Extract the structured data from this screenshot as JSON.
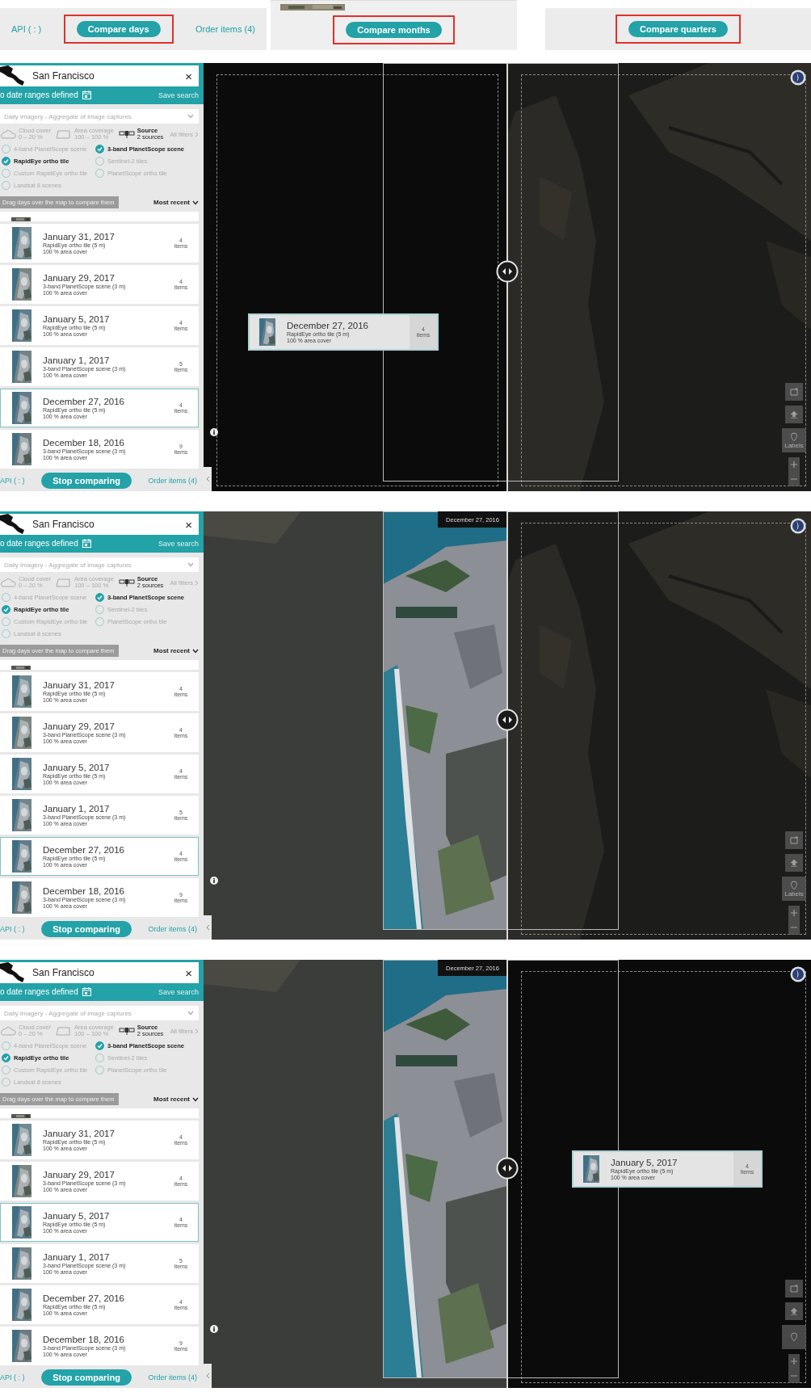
{
  "top_strip": [
    {
      "kind": "footer",
      "left_link": "API ( : )",
      "button": {
        "label": "Compare days",
        "highlighted": true
      },
      "right_link": "Order items (4)"
    },
    {
      "kind": "image_top",
      "button": {
        "label": "Compare months",
        "highlighted": true
      }
    },
    {
      "kind": "plain",
      "button": {
        "label": "Compare quarters",
        "highlighted": true
      }
    }
  ],
  "screens": [
    {
      "sidebar": {
        "search": {
          "value": "San Francisco",
          "close": "×"
        },
        "date_range": "o date ranges defined",
        "save_search": "Save search",
        "imagery_type": "Daily imagery - Aggregate of image captures",
        "filters": [
          {
            "kind": "cloud",
            "label": "Cloud cover",
            "value": "0 – 20 %",
            "active": false
          },
          {
            "kind": "area",
            "label": "Area coverage",
            "value": "100 – 100 %",
            "active": false
          },
          {
            "kind": "source",
            "label": "Source",
            "value": "2 sources",
            "active": true
          }
        ],
        "all_filters": "All filters",
        "sources": [
          {
            "label": "4-band PlanetScope scene",
            "checked": false
          },
          {
            "label": "3-band PlanetScope scene",
            "checked": true
          },
          {
            "label": "RapidEye ortho tile",
            "checked": true
          },
          {
            "label": "Sentinel-2 tiles",
            "checked": false
          },
          {
            "label": "Custom RapidEye ortho tile",
            "checked": false
          },
          {
            "label": "PlanetScope ortho tile",
            "checked": false
          },
          {
            "label": "Landsat 8 scenes",
            "checked": false
          }
        ],
        "hint": "Drag days over the map to compare them",
        "sort": "Most recent",
        "days": [
          {
            "date": "January 31, 2017",
            "source": "RapidEye ortho tile (5 m)",
            "cover": "100 % area cover",
            "count": "4",
            "unit": "items",
            "selected": false
          },
          {
            "date": "January 29, 2017",
            "source": "3-band PlanetScope scene (3 m)",
            "cover": "100 % area cover",
            "count": "4",
            "unit": "items",
            "selected": false
          },
          {
            "date": "January 5, 2017",
            "source": "RapidEye ortho tile (5 m)",
            "cover": "100 % area cover",
            "count": "4",
            "unit": "items",
            "selected": false
          },
          {
            "date": "January 1, 2017",
            "source": "3-band PlanetScope scene (3 m)",
            "cover": "100 % area cover",
            "count": "5",
            "unit": "items",
            "selected": false
          },
          {
            "date": "December 27, 2016",
            "source": "RapidEye ortho tile (5 m)",
            "cover": "100 % area cover",
            "count": "4",
            "unit": "items",
            "selected": true
          },
          {
            "date": "December 18, 2016",
            "source": "3-band PlanetScope scene (3 m)",
            "cover": "100 % area cover",
            "count": "9",
            "unit": "items",
            "selected": false
          }
        ],
        "footer": {
          "api": "API ( : )",
          "button": "Stop comparing",
          "order": "Order items (4)"
        }
      },
      "map": {
        "left_layer": {
          "kind": "black"
        },
        "right_layer": {
          "kind": "satellite"
        },
        "drag_card": {
          "kind": "left",
          "date": "December 27, 2016",
          "source": "RapidEye ortho tile (5 m)",
          "cover": "100 % area cover",
          "count": "4",
          "unit": "items"
        },
        "labels_control": "Labels"
      }
    },
    {
      "sidebar": {
        "search": {
          "value": "San Francisco",
          "close": "×"
        },
        "date_range": "o date ranges defined",
        "save_search": "Save search",
        "imagery_type": "Daily imagery - Aggregate of image captures",
        "filters": [
          {
            "kind": "cloud",
            "label": "Cloud cover",
            "value": "0 – 20 %",
            "active": false
          },
          {
            "kind": "area",
            "label": "Area coverage",
            "value": "100 – 100 %",
            "active": false
          },
          {
            "kind": "source",
            "label": "Source",
            "value": "2 sources",
            "active": true
          }
        ],
        "all_filters": "All filters",
        "sources": [
          {
            "label": "4-band PlanetScope scene",
            "checked": false
          },
          {
            "label": "3-band PlanetScope scene",
            "checked": true
          },
          {
            "label": "RapidEye ortho tile",
            "checked": true
          },
          {
            "label": "Sentinel-2 tiles",
            "checked": false
          },
          {
            "label": "Custom RapidEye ortho tile",
            "checked": false
          },
          {
            "label": "PlanetScope ortho tile",
            "checked": false
          },
          {
            "label": "Landsat 8 scenes",
            "checked": false
          }
        ],
        "hint": "Drag days over the map to compare them",
        "sort": "Most recent",
        "days": [
          {
            "date": "January 31, 2017",
            "source": "RapidEye ortho tile (5 m)",
            "cover": "100 % area cover",
            "count": "4",
            "unit": "items",
            "selected": false
          },
          {
            "date": "January 29, 2017",
            "source": "3-band PlanetScope scene (3 m)",
            "cover": "100 % area cover",
            "count": "4",
            "unit": "items",
            "selected": false
          },
          {
            "date": "January 5, 2017",
            "source": "RapidEye ortho tile (5 m)",
            "cover": "100 % area cover",
            "count": "4",
            "unit": "items",
            "selected": false
          },
          {
            "date": "January 1, 2017",
            "source": "3-band PlanetScope scene (3 m)",
            "cover": "100 % area cover",
            "count": "5",
            "unit": "items",
            "selected": false
          },
          {
            "date": "December 27, 2016",
            "source": "RapidEye ortho tile (5 m)",
            "cover": "100 % area cover",
            "count": "4",
            "unit": "items",
            "selected": true
          },
          {
            "date": "December 18, 2016",
            "source": "3-band PlanetScope scene (3 m)",
            "cover": "100 % area cover",
            "count": "9",
            "unit": "items",
            "selected": false
          }
        ],
        "footer": {
          "api": "API ( : )",
          "button": "Stop comparing",
          "order": "Order items (4)"
        }
      },
      "map": {
        "left_layer": {
          "kind": "satellite"
        },
        "right_layer": {
          "kind": "satellite"
        },
        "frame_label": "December 27, 2016",
        "labels_control": "Labels"
      }
    },
    {
      "sidebar": {
        "search": {
          "value": "San Francisco",
          "close": "×"
        },
        "date_range": "o date ranges defined",
        "save_search": "Save search",
        "imagery_type": "Daily imagery - Aggregate of image captures",
        "filters": [
          {
            "kind": "cloud",
            "label": "Cloud cover",
            "value": "0 – 20 %",
            "active": false
          },
          {
            "kind": "area",
            "label": "Area coverage",
            "value": "100 – 100 %",
            "active": false
          },
          {
            "kind": "source",
            "label": "Source",
            "value": "2 sources",
            "active": true
          }
        ],
        "all_filters": "All filters",
        "sources": [
          {
            "label": "4-band PlanetScope scene",
            "checked": false
          },
          {
            "label": "3-band PlanetScope scene",
            "checked": true
          },
          {
            "label": "RapidEye ortho tile",
            "checked": true
          },
          {
            "label": "Sentinel-2 tiles",
            "checked": false
          },
          {
            "label": "Custom RapidEye ortho tile",
            "checked": false
          },
          {
            "label": "PlanetScope ortho tile",
            "checked": false
          },
          {
            "label": "Landsat 8 scenes",
            "checked": false
          }
        ],
        "hint": "Drag days over the map to compare them",
        "sort": "Most recent",
        "days": [
          {
            "date": "January 31, 2017",
            "source": "RapidEye ortho tile (5 m)",
            "cover": "100 % area cover",
            "count": "4",
            "unit": "items",
            "selected": false
          },
          {
            "date": "January 29, 2017",
            "source": "3-band PlanetScope scene (3 m)",
            "cover": "100 % area cover",
            "count": "4",
            "unit": "items",
            "selected": false
          },
          {
            "date": "January 5, 2017",
            "source": "RapidEye ortho tile (5 m)",
            "cover": "100 % area cover",
            "count": "4",
            "unit": "items",
            "selected": true
          },
          {
            "date": "January 1, 2017",
            "source": "3-band PlanetScope scene (3 m)",
            "cover": "100 % area cover",
            "count": "5",
            "unit": "items",
            "selected": false
          },
          {
            "date": "December 27, 2016",
            "source": "RapidEye ortho tile (5 m)",
            "cover": "100 % area cover",
            "count": "4",
            "unit": "items",
            "selected": false
          },
          {
            "date": "December 18, 2016",
            "source": "3-band PlanetScope scene (3 m)",
            "cover": "100 % area cover",
            "count": "9",
            "unit": "items",
            "selected": false
          }
        ],
        "footer": {
          "api": "API ( : )",
          "button": "Stop comparing",
          "order": "Order items (4)"
        }
      },
      "map": {
        "left_layer": {
          "kind": "satellite"
        },
        "right_layer": {
          "kind": "black"
        },
        "frame_label": "December 27, 2016",
        "drag_card": {
          "kind": "right",
          "date": "January 5, 2017",
          "source": "RapidEye ortho tile (5 m)",
          "cover": "100 % area cover",
          "count": "4",
          "unit": "items"
        }
      }
    }
  ]
}
